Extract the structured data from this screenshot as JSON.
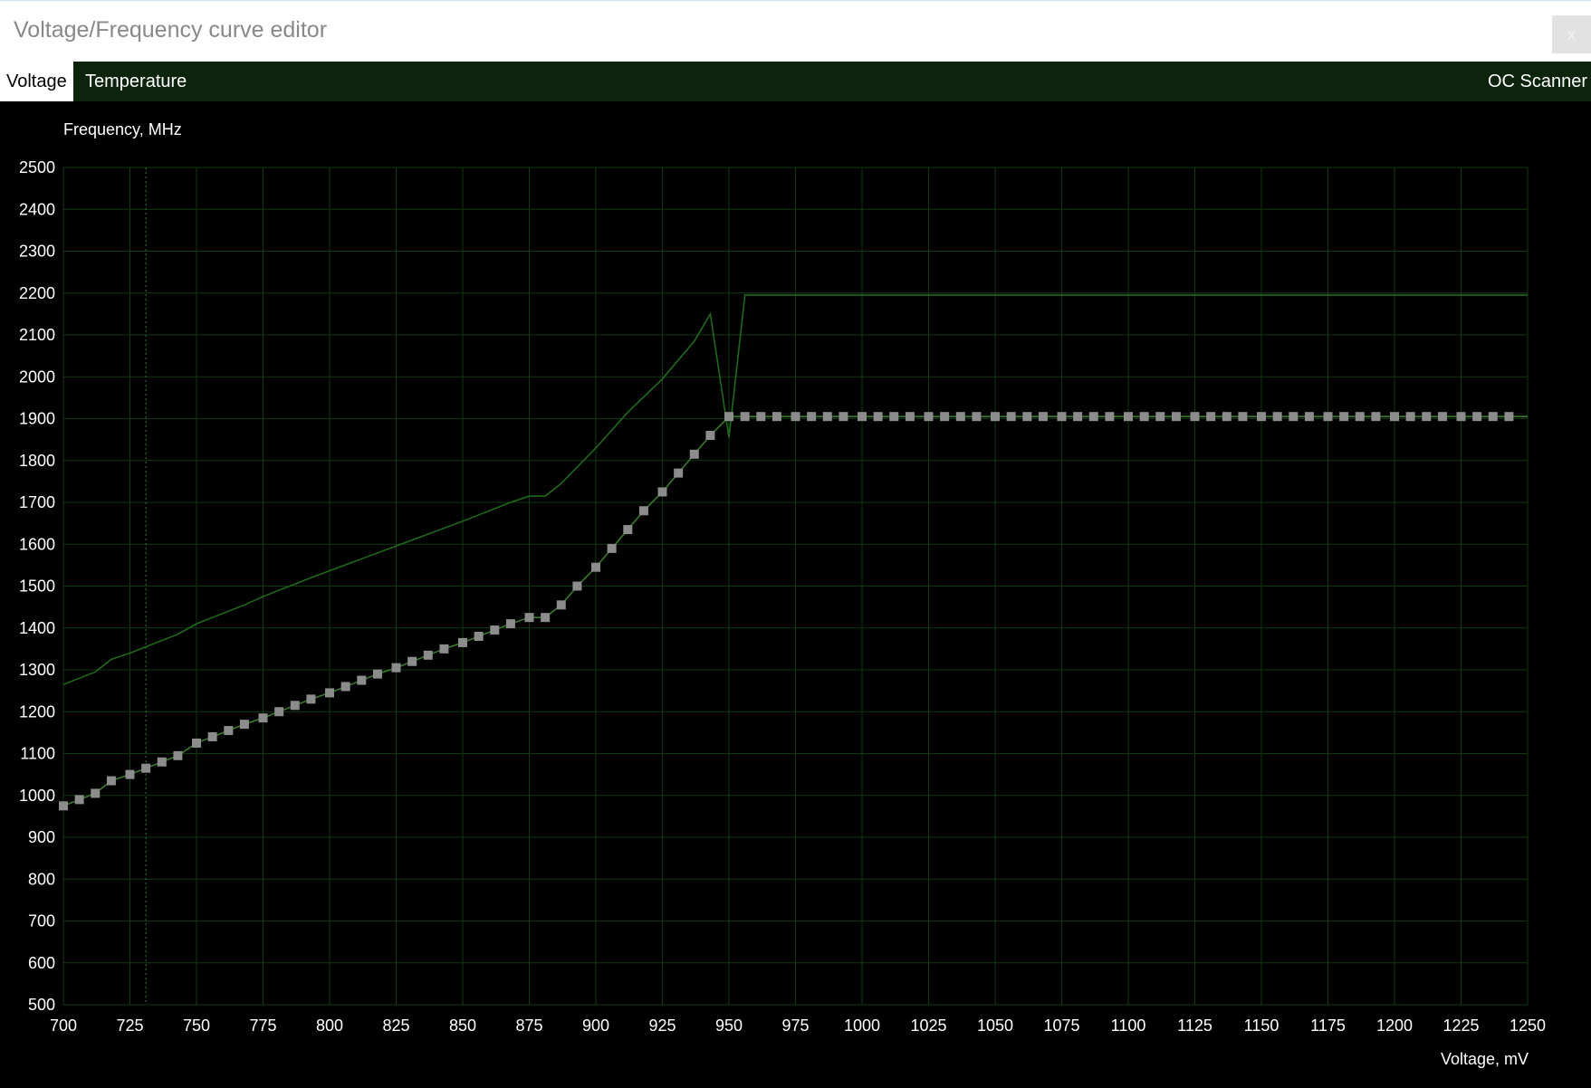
{
  "window": {
    "title": "Voltage/Frequency curve editor",
    "close_label": "x"
  },
  "tabs": [
    {
      "label": "Voltage",
      "active": true
    },
    {
      "label": "Temperature",
      "active": false
    },
    {
      "label": "OC Scanner",
      "active": false
    }
  ],
  "colors": {
    "background": "#000000",
    "grid": "#0f3a0f",
    "curve": "#3a7a2a",
    "reference_line": "#1f6a1a",
    "point": "#8c8c8c",
    "tab_bar": "#0c230c"
  },
  "chart_data": {
    "type": "line",
    "xlabel": "Voltage, mV",
    "ylabel": "Frequency, MHz",
    "xlim": [
      700,
      1250
    ],
    "ylim": [
      500,
      2500
    ],
    "xticks": [
      700,
      725,
      750,
      775,
      800,
      825,
      850,
      875,
      900,
      925,
      950,
      975,
      1000,
      1025,
      1050,
      1075,
      1100,
      1125,
      1150,
      1175,
      1200,
      1225,
      1250
    ],
    "yticks": [
      500,
      600,
      700,
      800,
      900,
      1000,
      1100,
      1200,
      1300,
      1400,
      1500,
      1600,
      1700,
      1800,
      1900,
      2000,
      2100,
      2200,
      2300,
      2400,
      2500
    ],
    "grid": true,
    "cursor_voltage": 731,
    "series": [
      {
        "role": "curve",
        "x": [
          700,
          706,
          712,
          718,
          725,
          731,
          737,
          743,
          750,
          756,
          762,
          768,
          775,
          781,
          787,
          793,
          800,
          806,
          812,
          818,
          825,
          831,
          837,
          843,
          850,
          856,
          862,
          868,
          875,
          881,
          887,
          893,
          900,
          906,
          912,
          918,
          925,
          931,
          937,
          943,
          950,
          956,
          962,
          968,
          975,
          981,
          987,
          993,
          1000,
          1006,
          1012,
          1018,
          1025,
          1031,
          1037,
          1043,
          1050,
          1056,
          1062,
          1068,
          1075,
          1081,
          1087,
          1093,
          1100,
          1106,
          1112,
          1118,
          1125,
          1131,
          1137,
          1143,
          1150,
          1156,
          1162,
          1168,
          1175,
          1181,
          1187,
          1193,
          1200,
          1206,
          1212,
          1218,
          1225,
          1231,
          1237,
          1243
        ],
        "y": [
          975,
          990,
          1005,
          1035,
          1050,
          1065,
          1080,
          1095,
          1125,
          1140,
          1155,
          1170,
          1185,
          1200,
          1215,
          1230,
          1245,
          1260,
          1275,
          1290,
          1305,
          1320,
          1335,
          1350,
          1365,
          1380,
          1395,
          1410,
          1425,
          1425,
          1455,
          1500,
          1545,
          1590,
          1635,
          1680,
          1725,
          1770,
          1815,
          1860,
          1905,
          1905,
          1905,
          1905,
          1905,
          1905,
          1905,
          1905,
          1905,
          1905,
          1905,
          1905,
          1905,
          1905,
          1905,
          1905,
          1905,
          1905,
          1905,
          1905,
          1905,
          1905,
          1905,
          1905,
          1905,
          1905,
          1905,
          1905,
          1905,
          1905,
          1905,
          1905,
          1905,
          1905,
          1905,
          1905,
          1905,
          1905,
          1905,
          1905,
          1905,
          1905,
          1905,
          1905,
          1905,
          1905,
          1905,
          1905
        ]
      },
      {
        "role": "reference",
        "x": [
          700,
          712,
          718,
          725,
          737,
          743,
          750,
          756,
          768,
          775,
          793,
          812,
          831,
          850,
          868,
          875,
          881,
          887,
          900,
          912,
          925,
          937,
          943,
          950,
          956,
          1250
        ],
        "y": [
          1265,
          1295,
          1325,
          1340,
          1370,
          1385,
          1410,
          1425,
          1455,
          1475,
          1520,
          1565,
          1610,
          1655,
          1700,
          1715,
          1715,
          1745,
          1830,
          1915,
          1995,
          2085,
          2150,
          1855,
          2195,
          2195
        ]
      }
    ]
  }
}
